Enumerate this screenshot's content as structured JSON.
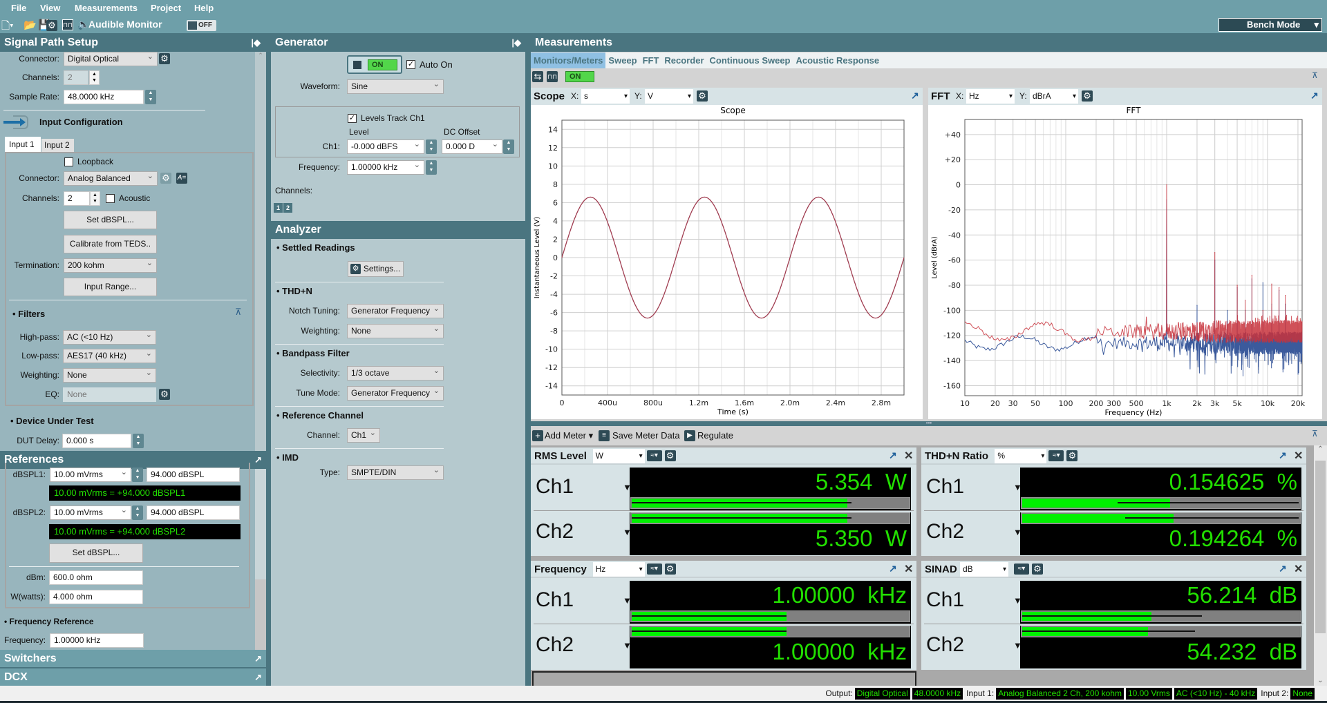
{
  "menu": [
    "File",
    "View",
    "Measurements",
    "Project",
    "Help"
  ],
  "toolbar": {
    "audible_monitor": "Audible Monitor",
    "toggle": "OFF",
    "mode": "Bench Mode"
  },
  "signal_path": {
    "title": "Signal Path Setup",
    "output": {
      "connector_label": "Connector:",
      "connector": "Digital Optical",
      "channels_label": "Channels:",
      "channels": "2",
      "sample_rate_label": "Sample Rate:",
      "sample_rate": "48.0000 kHz"
    },
    "input_config": {
      "title": "Input Configuration",
      "tabs": [
        "Input 1",
        "Input 2"
      ],
      "loopback": "Loopback",
      "connector_label": "Connector:",
      "connector": "Analog Balanced",
      "channels_label": "Channels:",
      "channels": "2",
      "acoustic": "Acoustic",
      "set_dbspl": "Set dBSPL...",
      "calibrate": "Calibrate from TEDS..",
      "termination_label": "Termination:",
      "termination": "200 kohm",
      "input_range": "Input Range..."
    },
    "filters": {
      "title": "• Filters",
      "highpass_label": "High-pass:",
      "highpass": "AC (<10 Hz)",
      "lowpass_label": "Low-pass:",
      "lowpass": "AES17 (40 kHz)",
      "weighting_label": "Weighting:",
      "weighting": "None",
      "eq_label": "EQ:",
      "eq": "None"
    },
    "dut": {
      "title": "• Device Under Test",
      "delay_label": "DUT Delay:",
      "delay": "0.000 s"
    }
  },
  "references": {
    "title": "References",
    "dbspl1_label": "dBSPL1:",
    "dbspl1_v": "10.00 mVrms",
    "dbspl1_db": "94.000 dBSPL",
    "dbspl1_readout": "10.00 mVrms = +94.000 dBSPL1",
    "dbspl2_label": "dBSPL2:",
    "dbspl2_v": "10.00 mVrms",
    "dbspl2_db": "94.000 dBSPL",
    "dbspl2_readout": "10.00 mVrms = +94.000 dBSPL2",
    "set_dbspl": "Set dBSPL...",
    "dbm_label": "dBm:",
    "dbm": "600.0 ohm",
    "watts_label": "W(watts):",
    "watts": "4.000 ohm",
    "freq_ref_title": "• Frequency Reference",
    "freq_label": "Frequency:",
    "freq": "1.00000 kHz"
  },
  "switchers": "Switchers",
  "dcx": "DCX",
  "generator": {
    "title": "Generator",
    "on": "ON",
    "auto_on": "Auto On",
    "waveform_label": "Waveform:",
    "waveform": "Sine",
    "levels_track": "Levels Track Ch1",
    "level_header": "Level",
    "dc_header": "DC Offset",
    "ch1_label": "Ch1:",
    "level": "-0.000 dBFS",
    "dc": "0.000 D",
    "freq_label": "Frequency:",
    "freq": "1.00000 kHz",
    "channels_label": "Channels:",
    "channel_buttons": [
      "1",
      "2"
    ]
  },
  "analyzer": {
    "title": "Analyzer",
    "settled": "• Settled Readings",
    "settings": "Settings...",
    "thdn": "• THD+N",
    "notch_label": "Notch Tuning:",
    "notch": "Generator Frequency",
    "weighting_label": "Weighting:",
    "weighting": "None",
    "bandpass": "• Bandpass Filter",
    "selectivity_label": "Selectivity:",
    "selectivity": "1/3 octave",
    "tune_label": "Tune Mode:",
    "tune": "Generator Frequency",
    "refch": "• Reference Channel",
    "channel_label": "Channel:",
    "channel": "Ch1",
    "imd": "• IMD",
    "type_label": "Type:",
    "type": "SMPTE/DIN"
  },
  "measurements": {
    "title": "Measurements",
    "tabs": [
      "Monitors/Meters",
      "Sweep",
      "FFT",
      "Recorder",
      "Continuous Sweep",
      "Acoustic Response"
    ],
    "active_tab": "Monitors/Meters",
    "monitor_on": "ON",
    "scope": {
      "title": "Scope",
      "x_label": "X:",
      "x_unit": "s",
      "y_label": "Y:",
      "y_unit": "V"
    },
    "fft": {
      "title": "FFT",
      "x_label": "X:",
      "x_unit": "Hz",
      "y_label": "Y:",
      "y_unit": "dBrA"
    },
    "meter_toolbar": {
      "add": "Add Meter",
      "save": "Save Meter Data",
      "regulate": "Regulate"
    },
    "meters": [
      {
        "title": "RMS Level",
        "unit": "W",
        "channels": [
          {
            "label": "Ch1",
            "value": "5.354",
            "unit": "W",
            "fill": 0.78,
            "line": [
              0,
              0.795
            ]
          },
          {
            "label": "Ch2",
            "value": "5.350",
            "unit": "W",
            "fill": 0.78,
            "line": [
              0,
              0.795
            ]
          }
        ]
      },
      {
        "title": "THD+N Ratio",
        "unit": "%",
        "channels": [
          {
            "label": "Ch1",
            "value": "0.154625",
            "unit": "%",
            "fill": 0.534,
            "line": [
              0.345,
              1.0
            ]
          },
          {
            "label": "Ch2",
            "value": "0.194264",
            "unit": "%",
            "fill": 0.548,
            "line": [
              0.372,
              1.0
            ]
          }
        ]
      },
      {
        "title": "Frequency",
        "unit": "Hz",
        "channels": [
          {
            "label": "Ch1",
            "value": "1.00000",
            "unit": "kHz",
            "fill": 0.56,
            "line": [
              0,
              0.56
            ]
          },
          {
            "label": "Ch2",
            "value": "1.00000",
            "unit": "kHz",
            "fill": 0.56,
            "line": [
              0,
              0.56
            ]
          }
        ]
      },
      {
        "title": "SINAD",
        "unit": "dB",
        "channels": [
          {
            "label": "Ch1",
            "value": "56.214",
            "unit": "dB",
            "fill": 0.468,
            "line": [
              0,
              0.65
            ]
          },
          {
            "label": "Ch2",
            "value": "54.232",
            "unit": "dB",
            "fill": 0.455,
            "line": [
              0,
              0.625
            ]
          }
        ]
      }
    ]
  },
  "status": {
    "output_label": "Output:",
    "output": [
      "Digital Optical",
      "48.0000 kHz"
    ],
    "input1_label": "Input 1:",
    "input1": [
      "Analog Balanced 2 Ch, 200 kohm",
      "10.00 Vrms",
      "AC (<10 Hz) - 40 kHz"
    ],
    "input2_label": "Input 2:",
    "input2": [
      "None"
    ]
  },
  "colors": {
    "header": "#4a7580",
    "accent_tab": "#8fc0e3",
    "meter_green": "#22e000",
    "scope_trace": "#a03c50",
    "fft_red": "#c8323c",
    "fft_blue": "#3b5a9c"
  },
  "chart_data": [
    {
      "type": "line",
      "title": "Scope",
      "xlabel": "Time (s)",
      "ylabel": "Instantaneous Level (V)",
      "xlim": [
        0,
        0.003
      ],
      "ylim": [
        -15,
        15
      ],
      "xticks": [
        0,
        0.0004,
        0.0008,
        0.0012,
        0.0016,
        0.002,
        0.0024,
        0.0028
      ],
      "xtick_labels": [
        "0",
        "400u",
        "800u",
        "1.2m",
        "1.6m",
        "2.0m",
        "2.4m",
        "2.8m"
      ],
      "yticks": [
        14,
        12,
        10,
        8,
        6,
        4,
        2,
        0,
        -2,
        -4,
        -6,
        -8,
        -10,
        -12,
        -14
      ],
      "ytick_labels": [
        "14",
        "12",
        "10",
        "8",
        "6",
        "4",
        "2",
        "0",
        "-2",
        "-4",
        "-6",
        "-8",
        "-10",
        "-12",
        "-14"
      ],
      "grid": true,
      "series": [
        {
          "waveform": "sine",
          "amplitude_V": 6.6,
          "frequency_Hz": 1000,
          "color": "#a03c50"
        }
      ]
    },
    {
      "type": "line",
      "title": "FFT",
      "xlabel": "Frequency (Hz)",
      "ylabel": "Level (dBrA)",
      "xscale": "log",
      "xlim": [
        10,
        22000
      ],
      "ylim": [
        -168,
        52
      ],
      "xticks": [
        10,
        20,
        30,
        50,
        100,
        200,
        300,
        500,
        1000,
        2000,
        3000,
        5000,
        10000,
        20000
      ],
      "xtick_labels": [
        "10",
        "20",
        "30",
        "50",
        "100",
        "200",
        "300",
        "500",
        "1k",
        "2k",
        "3k",
        "5k",
        "10k",
        "20k"
      ],
      "yticks": [
        40,
        20,
        0,
        -20,
        -40,
        -60,
        -80,
        -100,
        -120,
        -140,
        -160
      ],
      "ytick_labels": [
        "+40",
        "+20",
        "0",
        "-20",
        "-40",
        "-60",
        "-80",
        "-100",
        "-120",
        "-140",
        "-160"
      ],
      "grid": true,
      "series": [
        {
          "color": "#3b5a9c",
          "noise_floor_dB": -126,
          "peaks": [
            [
              1000,
              -12
            ],
            [
              2000,
              -96
            ],
            [
              3000,
              -60
            ],
            [
              4000,
              -100
            ],
            [
              5000,
              -82
            ],
            [
              6000,
              -100
            ],
            [
              7000,
              -75
            ],
            [
              9000,
              -78
            ],
            [
              11000,
              -95
            ],
            [
              13000,
              -84
            ],
            [
              15000,
              -95
            ]
          ]
        },
        {
          "color": "#c8323c",
          "noise_floor_dB": -117,
          "peaks": [
            [
              1000,
              0
            ],
            [
              2000,
              -110
            ],
            [
              3000,
              -54
            ],
            [
              4000,
              -118
            ],
            [
              5000,
              -80
            ],
            [
              6000,
              -92
            ],
            [
              7000,
              -72
            ],
            [
              9000,
              -100
            ],
            [
              11000,
              -79
            ],
            [
              13000,
              -82
            ],
            [
              15000,
              -88
            ]
          ]
        }
      ]
    }
  ]
}
